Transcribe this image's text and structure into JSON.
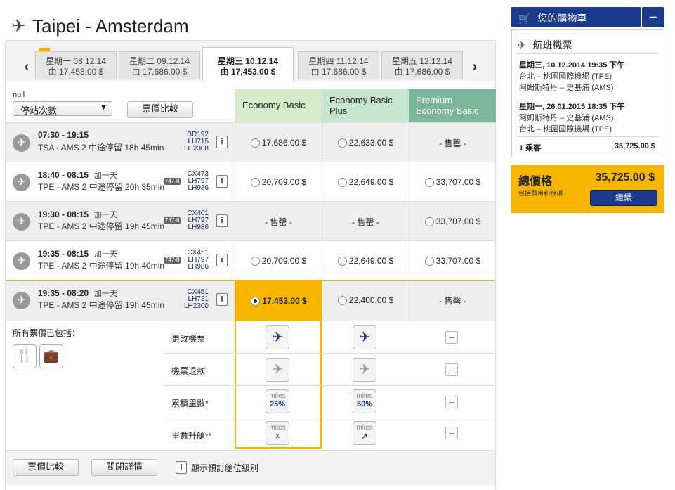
{
  "header": {
    "title": "Taipei - Amsterdam"
  },
  "date_tabs": [
    {
      "day": "星期一 08.12.14",
      "price": "由 17,453.00 $",
      "active": false
    },
    {
      "day": "星期二 09.12.14",
      "price": "由 17,686.00 $",
      "active": false
    },
    {
      "day": "星期三 10.12.14",
      "price": "由 17,453.00 $",
      "active": true
    },
    {
      "day": "星期四 11.12.14",
      "price": "由 17,686.00 $",
      "active": false
    },
    {
      "day": "星期五 12.12.14",
      "price": "由 17,686.00 $",
      "active": false
    }
  ],
  "nav": {
    "prev": "‹",
    "next": "›"
  },
  "filters": {
    "null_label": "null",
    "stops_select": "停站次數",
    "compare_button": "票價比較"
  },
  "fare_columns": [
    {
      "name": "Economy Basic",
      "color": "#d9ecc9"
    },
    {
      "name": "Economy Basic Plus",
      "color": "#c6e6cf"
    },
    {
      "name": "Premium Economy Basic",
      "color": "#7bb59a"
    }
  ],
  "flights": [
    {
      "times": "07:30 - 19:15",
      "next_day": "",
      "route": "TSA - AMS  2 中途停留  18h 45min",
      "codes": [
        "BR192",
        "LH715",
        "LH2308"
      ],
      "aircraft": "",
      "fares": [
        "17,686.00 $",
        "22,633.00 $",
        "- 售罄 -"
      ]
    },
    {
      "times": "18:40 - 08:15",
      "next_day": "加一天",
      "route": "TPE - AMS  2 中途停留  20h 35min",
      "codes": [
        "CX473",
        "LH797",
        "LH986"
      ],
      "aircraft": "747-8",
      "fares": [
        "20,709.00 $",
        "22,649.00 $",
        "33,707.00 $"
      ]
    },
    {
      "times": "19:30 - 08:15",
      "next_day": "加一天",
      "route": "TPE - AMS  2 中途停留  19h 45min",
      "codes": [
        "CX401",
        "LH797",
        "LH986"
      ],
      "aircraft": "747-8",
      "fares": [
        "- 售罄 -",
        "- 售罄 -",
        "33,707.00 $"
      ]
    },
    {
      "times": "19:35 - 08:15",
      "next_day": "加一天",
      "route": "TPE - AMS  2 中途停留  19h 40min",
      "codes": [
        "CX451",
        "LH797",
        "LH986"
      ],
      "aircraft": "747-8",
      "fares": [
        "20,709.00 $",
        "22,649.00 $",
        "33,707.00 $"
      ]
    },
    {
      "times": "19:35 - 08:20",
      "next_day": "加一天",
      "route": "TPE - AMS  2 中途停留  19h 45min",
      "codes": [
        "CX451",
        "LH731",
        "LH2300"
      ],
      "aircraft": "",
      "fares": [
        "17,453.00 $",
        "22,400.00 $",
        "- 售罄 -"
      ]
    }
  ],
  "included": {
    "label": "所有票價已包括："
  },
  "benefits": [
    {
      "label": "更改機票",
      "basic": "plane-euro",
      "plus": "plane-euro"
    },
    {
      "label": "機票退款",
      "basic": "plane-x",
      "plus": "plane-euro"
    },
    {
      "label": "累積里數*",
      "basic": "miles",
      "basic_value": "25%",
      "plus": "miles",
      "plus_value": "50%"
    },
    {
      "label": "里數升艙**",
      "basic": "miles",
      "basic_value": "x",
      "plus": "miles",
      "plus_value": "↗"
    }
  ],
  "miles_word": "miles",
  "bottom": {
    "compare": "票價比較",
    "close_details": "關閉詳情",
    "show_class": "顯示預訂艙位級別",
    "info": "i"
  },
  "cart": {
    "title": "您的購物車",
    "toggle": "–",
    "section": "航班機票",
    "outbound_date": "星期三, 10.12.2014 19:35 下午",
    "outbound_from": "台北 – 桃園國際機場 (TPE)",
    "outbound_to": "阿姆斯特丹 – 史基浦 (AMS)",
    "return_date": "星期一, 26.01.2015 18:35 下午",
    "return_from": "阿姆斯特丹 – 史基浦 (AMS)",
    "return_to": "台北 – 桃園國際機場 (TPE)",
    "passengers": "1 乘客",
    "passenger_total": "35,725.00 $",
    "total_label": "總價格",
    "total_value": "35,725.00 $",
    "total_note": "包括費用和稅項 ·",
    "continue": "繼續"
  },
  "colors": {
    "accent": "#f7b500",
    "brand": "#1c3a8c"
  }
}
